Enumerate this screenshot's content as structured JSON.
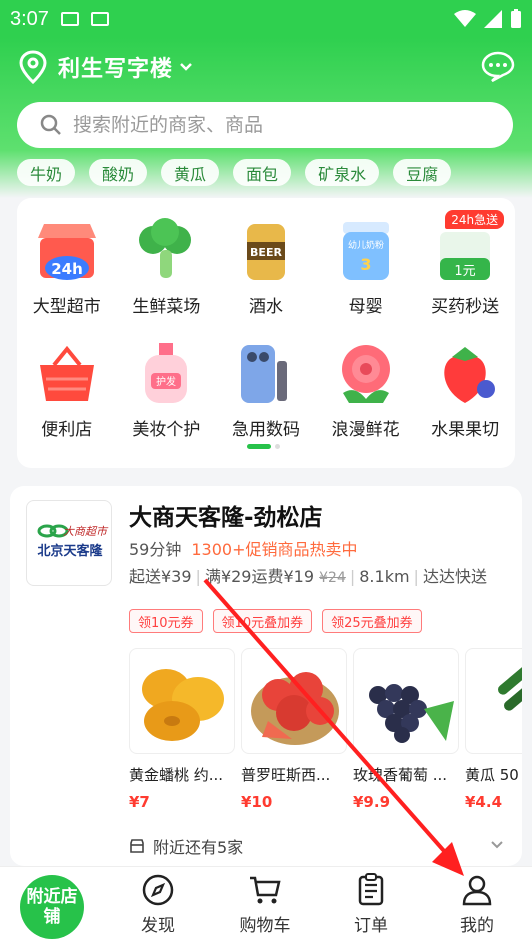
{
  "status_bar": {
    "time": "3:07"
  },
  "header": {
    "location": "利生写字楼",
    "search_placeholder": "搜索附近的商家、商品"
  },
  "chips": [
    "牛奶",
    "酸奶",
    "黄瓜",
    "面包",
    "矿泉水",
    "豆腐"
  ],
  "categories": [
    {
      "label": "大型超市",
      "icon": "supermarket-icon",
      "badge": "24h"
    },
    {
      "label": "生鲜菜场",
      "icon": "broccoli-icon"
    },
    {
      "label": "酒水",
      "icon": "beer-can-icon",
      "badge": "BEER"
    },
    {
      "label": "母婴",
      "icon": "milk-powder-icon",
      "badge": "幼儿奶粉"
    },
    {
      "label": "买药秒送",
      "icon": "medicine-box-icon",
      "badge": "24h急送",
      "price": "1元"
    },
    {
      "label": "便利店",
      "icon": "basket-icon"
    },
    {
      "label": "美妆个护",
      "icon": "lotion-bottle-icon",
      "badge": "护发"
    },
    {
      "label": "急用数码",
      "icon": "phone-cable-icon"
    },
    {
      "label": "浪漫鲜花",
      "icon": "rose-icon"
    },
    {
      "label": "水果果切",
      "icon": "strawberry-icon"
    }
  ],
  "store": {
    "name": "大商天客隆-劲松店",
    "logo_text": "北京天客隆",
    "logo_brand": "大商超市",
    "delivery_time": "59分钟",
    "promo": "1300+促销商品热卖中",
    "min_order": "起送¥39",
    "shipping": "满¥29运费¥19",
    "old_shipping": "¥24",
    "distance": "8.1km",
    "courier": "达达快送",
    "coupons": [
      "领10元券",
      "领10元叠加券",
      "领25元叠加券"
    ],
    "products": [
      {
        "name": "黄金蟠桃 约...",
        "price": "¥7",
        "icon": "peach-icon"
      },
      {
        "name": "普罗旺斯西...",
        "price": "¥10",
        "icon": "tomato-icon"
      },
      {
        "name": "玫瑰香葡萄 ...",
        "price": "¥9.9",
        "icon": "grape-icon"
      },
      {
        "name": "黄瓜 50",
        "price": "¥4.4",
        "icon": "cucumber-icon"
      }
    ],
    "nearby": "附近还有5家"
  },
  "tabbar": {
    "home": "附近店铺",
    "tabs": [
      "发现",
      "购物车",
      "订单",
      "我的"
    ]
  },
  "colors": {
    "brand_green": "#27c24a",
    "price_red": "#ff3b30",
    "promo_orange": "#ff6a3d"
  }
}
